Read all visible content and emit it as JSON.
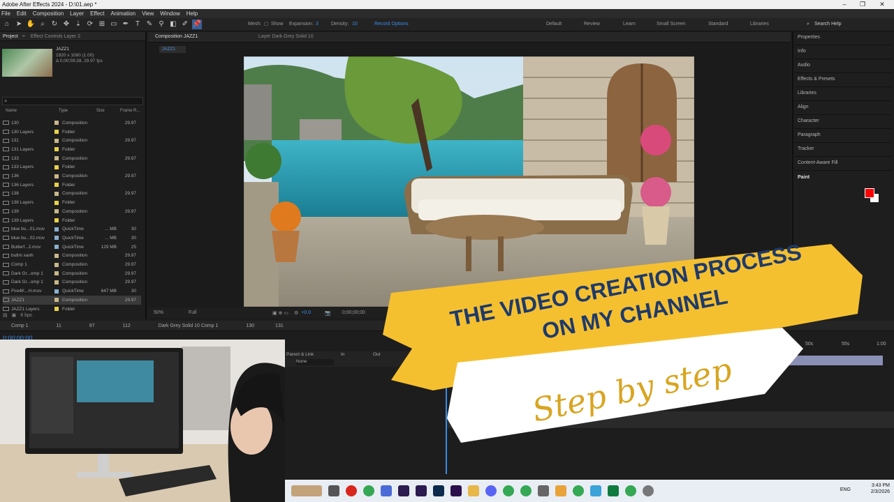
{
  "titlebar": {
    "title": "Adobe After Effects 2024 - D:\\01.aep *",
    "minimize": "–",
    "restore": "❐",
    "close": "✕"
  },
  "menu": [
    "File",
    "Edit",
    "Composition",
    "Layer",
    "Effect",
    "Animation",
    "View",
    "Window",
    "Help"
  ],
  "toolbar": {
    "mesh_label": "Mesh:",
    "show_label": "Show",
    "expansion_label": "Expansion:",
    "expansion_value": "3",
    "density_label": "Density:",
    "density_value": "10",
    "record_options": "Record Options",
    "workspaces": [
      "Default",
      "Review",
      "Learn",
      "Small Screen",
      "Standard",
      "Libraries"
    ],
    "search_help": "Search Help"
  },
  "project_panel": {
    "tab_project": "Project",
    "tab_effect_controls": "Effect Controls Layer 2",
    "selected_item": "JAZZ1",
    "item_info_1": "1920 x 1080 (1.00)",
    "item_info_2": "Δ 0;00;59;28, 29.97 fps",
    "columns": [
      "Name",
      "Type",
      "Size",
      "Frame R..."
    ],
    "rows": [
      {
        "name": "130",
        "type": "Composition",
        "size": "",
        "fps": "29.97"
      },
      {
        "name": "130 Layers",
        "type": "Folder",
        "size": "",
        "fps": ""
      },
      {
        "name": "131",
        "type": "Composition",
        "size": "",
        "fps": "29.97"
      },
      {
        "name": "131 Layers",
        "type": "Folder",
        "size": "",
        "fps": ""
      },
      {
        "name": "133",
        "type": "Composition",
        "size": "",
        "fps": "29.97"
      },
      {
        "name": "133 Layers",
        "type": "Folder",
        "size": "",
        "fps": ""
      },
      {
        "name": "136",
        "type": "Composition",
        "size": "",
        "fps": "29.97"
      },
      {
        "name": "136 Layers",
        "type": "Folder",
        "size": "",
        "fps": ""
      },
      {
        "name": "138",
        "type": "Composition",
        "size": "",
        "fps": "29.97"
      },
      {
        "name": "138 Layers",
        "type": "Folder",
        "size": "",
        "fps": ""
      },
      {
        "name": "139",
        "type": "Composition",
        "size": "",
        "fps": "29.97"
      },
      {
        "name": "139 Layers",
        "type": "Folder",
        "size": "",
        "fps": ""
      },
      {
        "name": "blue bu...01.mov",
        "type": "QuickTime",
        "size": "... MB",
        "fps": "30"
      },
      {
        "name": "blue bu...02.mov",
        "type": "QuickTime",
        "size": "... MB",
        "fps": "30"
      },
      {
        "name": "Butterf...2.mov",
        "type": "QuickTime",
        "size": "129 MB",
        "fps": "25"
      },
      {
        "name": "butlm xanh",
        "type": "Composition",
        "size": "",
        "fps": "29.97"
      },
      {
        "name": "Comp 1",
        "type": "Composition",
        "size": "",
        "fps": "29.97"
      },
      {
        "name": "Dark Gr...omp 1",
        "type": "Composition",
        "size": "",
        "fps": "29.97"
      },
      {
        "name": "Dark Gr...omp 1",
        "type": "Composition",
        "size": "",
        "fps": "29.97"
      },
      {
        "name": "Fire4K...H.mov",
        "type": "QuickTime",
        "size": "647 MB",
        "fps": "30"
      },
      {
        "name": "JAZZ1",
        "type": "Composition",
        "size": "",
        "fps": "29.97"
      },
      {
        "name": "JAZZ1 Layers",
        "type": "Folder",
        "size": "",
        "fps": ""
      }
    ],
    "footer": "8 bpc"
  },
  "composition_panel": {
    "tab_label": "Composition JAZZ1",
    "layer_tab": "Layer Dark Grey Solid 10",
    "comp_name": "JAZZ1",
    "zoom": "50%",
    "resolution": "Full",
    "exposure": "+0.0",
    "timecode": "0;00;00;00"
  },
  "right_panel": {
    "items": [
      "Properties",
      "Info",
      "Audio",
      "Effects & Presets",
      "Libraries",
      "Align",
      "Character",
      "Paragraph",
      "Tracker",
      "Content-Aware Fill"
    ],
    "paint_title": "Paint"
  },
  "timeline": {
    "tabs": [
      "Comp 1",
      "11",
      "97",
      "112",
      "Dark Grey Solid 10 Comp 1",
      "130",
      "131"
    ],
    "timecode": "0;00;00;00",
    "parent_link": "Parent & Link",
    "parent_value": "None",
    "in_label": "In",
    "out_label": "Out",
    "ruler_labels": [
      "50s",
      "55s",
      "1:00"
    ]
  },
  "overlay": {
    "headline_line1": "THE VIDEO CREATION PROCESS",
    "headline_line2": "ON MY CHANNEL",
    "subtitle": "Step by step",
    "headline_color": "#1e3a6b",
    "highlight_color": "#f5c030",
    "subtitle_color": "#d9a520"
  },
  "taskbar": {
    "language": "ENG",
    "time": "3:43 PM",
    "date": "2/3/2026"
  }
}
